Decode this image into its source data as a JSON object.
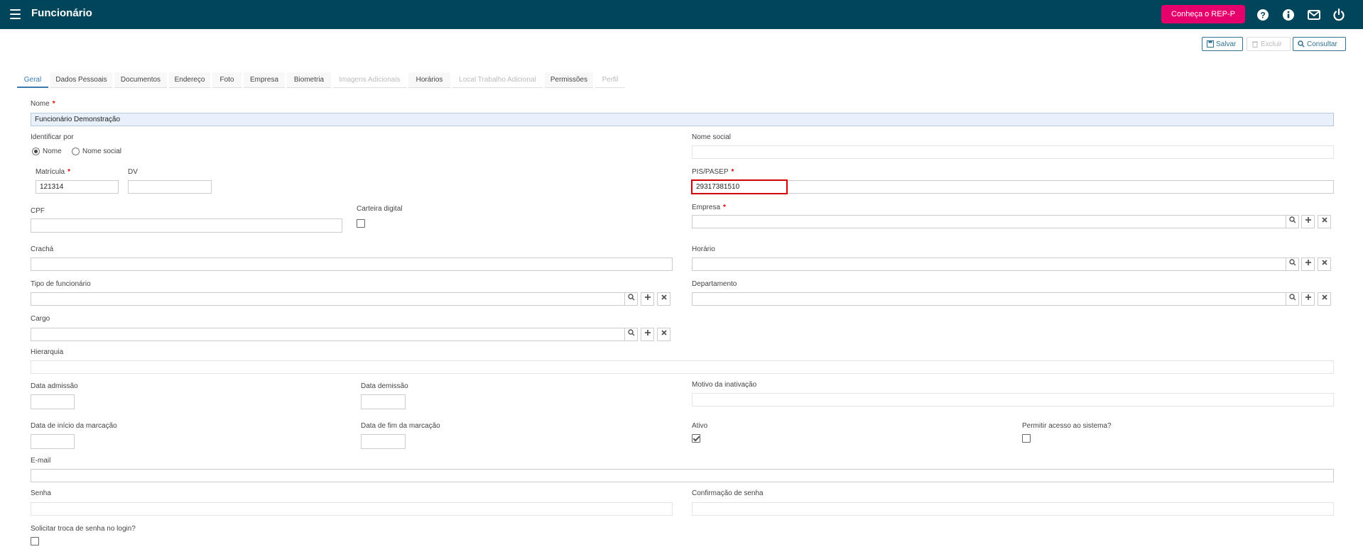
{
  "header": {
    "title": "Funcionário",
    "promo_button": "Conheça o REP-P",
    "icons": [
      "help-icon",
      "info-icon",
      "mail-icon",
      "power-icon"
    ]
  },
  "toolbar": {
    "save": "Salvar",
    "delete": "Excluir",
    "query": "Consultar"
  },
  "tabs": [
    {
      "label": "Geral",
      "state": "active"
    },
    {
      "label": "Dados Pessoais",
      "state": "normal"
    },
    {
      "label": "Documentos",
      "state": "normal"
    },
    {
      "label": "Endereço",
      "state": "normal"
    },
    {
      "label": "Foto",
      "state": "normal"
    },
    {
      "label": "Empresa",
      "state": "normal"
    },
    {
      "label": "Biometria",
      "state": "normal"
    },
    {
      "label": "Imagens Adicionais",
      "state": "disabled"
    },
    {
      "label": "Horários",
      "state": "normal"
    },
    {
      "label": "Local Trabalho Adicional",
      "state": "disabled"
    },
    {
      "label": "Permissões",
      "state": "normal"
    },
    {
      "label": "Perfil",
      "state": "disabled"
    }
  ],
  "form": {
    "nome": {
      "label": "Nome",
      "value": "Funcionário Demonstração"
    },
    "identificar_por": {
      "label": "Identificar por",
      "options": [
        "Nome",
        "Nome social"
      ],
      "selected": "Nome"
    },
    "nome_social": {
      "label": "Nome social",
      "value": ""
    },
    "matricula": {
      "label": "Matrícula",
      "value": "121314"
    },
    "dv": {
      "label": "DV",
      "value": ""
    },
    "pis_pasep": {
      "label": "PIS/PASEP",
      "value": "29317381510"
    },
    "cpf": {
      "label": "CPF",
      "value": ""
    },
    "carteira_digital": {
      "label": "Carteira digital",
      "checked": false
    },
    "empresa": {
      "label": "Empresa",
      "value": ""
    },
    "cracha": {
      "label": "Crachá",
      "value": ""
    },
    "horario": {
      "label": "Horário",
      "value": ""
    },
    "tipo_funcionario": {
      "label": "Tipo de funcionário",
      "value": ""
    },
    "departamento": {
      "label": "Departamento",
      "value": ""
    },
    "cargo": {
      "label": "Cargo",
      "value": ""
    },
    "hierarquia": {
      "label": "Hierarquia",
      "value": ""
    },
    "data_admissao": {
      "label": "Data admissão",
      "value": ""
    },
    "data_demissao": {
      "label": "Data demissão",
      "value": ""
    },
    "motivo_inativacao": {
      "label": "Motivo da inativação",
      "value": ""
    },
    "data_inicio_marcacao": {
      "label": "Data de início da marcação",
      "value": ""
    },
    "data_fim_marcacao": {
      "label": "Data de fim da marcação",
      "value": ""
    },
    "ativo": {
      "label": "Ativo",
      "checked": true
    },
    "permitir_acesso": {
      "label": "Permitir acesso ao sistema?",
      "checked": false
    },
    "email": {
      "label": "E-mail",
      "value": ""
    },
    "senha": {
      "label": "Senha",
      "value": ""
    },
    "confirmacao_senha": {
      "label": "Confirmação de senha",
      "value": ""
    },
    "solicitar_troca": {
      "label": "Solicitar troca de senha no login?",
      "checked": false
    }
  },
  "colors": {
    "header_bg": "#004559",
    "promo_bg": "#e5006b",
    "accent": "#3a7bb0",
    "required": "#dd0000",
    "highlight_border": "#d40000"
  }
}
